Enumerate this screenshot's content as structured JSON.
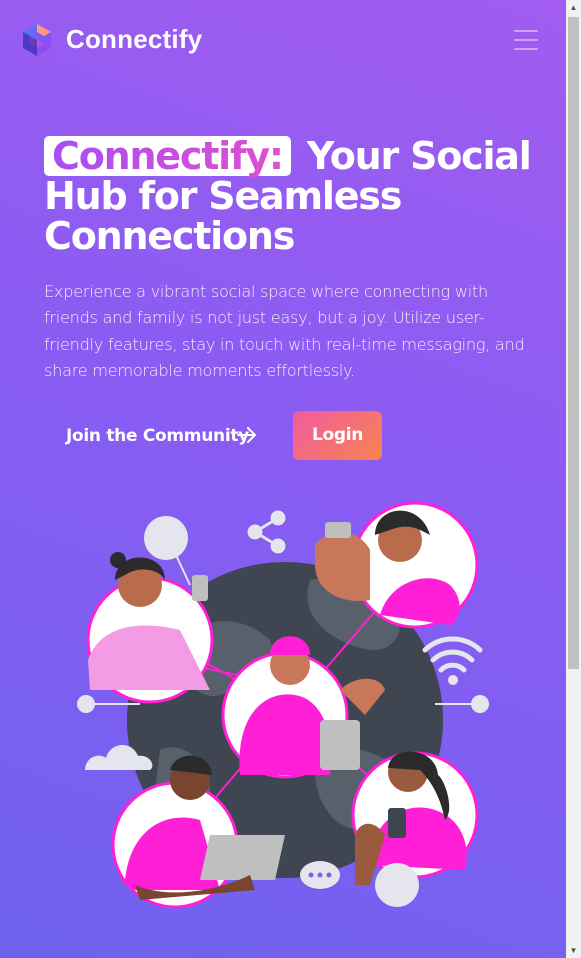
{
  "navbar": {
    "brand": "Connectify",
    "logo_icon": "connectify-logo-icon",
    "menu_icon": "hamburger-menu-icon"
  },
  "hero": {
    "title_highlight": "Connectify:",
    "title_rest": " Your Social Hub for Seamless Connections",
    "description": "Experience a vibrant social space where connecting with friends and family is not just easy, but a joy. Utilize user-friendly features, stay in touch with real-time messaging, and share memorable moments effortlessly.",
    "join_label": "Join the Community",
    "join_icon": "arrow-right-icon",
    "login_label": "Login"
  },
  "illustration": {
    "name": "social-network-globe-illustration"
  },
  "colors": {
    "background_top": "#a25cf0",
    "background_bottom": "#6f62ef",
    "accent_pink": "#ff1fd6",
    "login_gradient_start": "#f25ba0",
    "login_gradient_end": "#f7834f"
  }
}
